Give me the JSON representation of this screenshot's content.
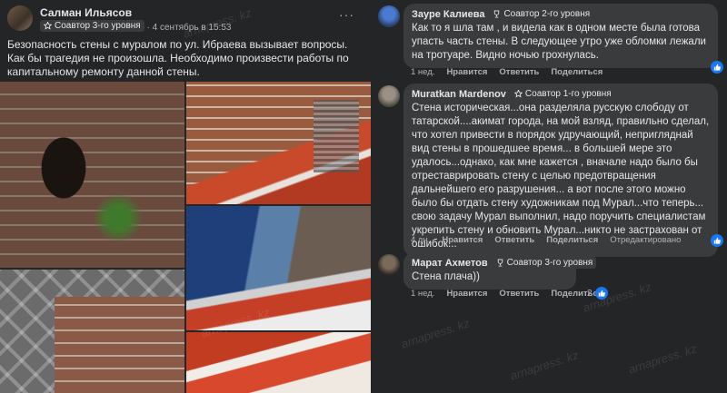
{
  "post": {
    "author": "Салман Ильясов",
    "badge": "Соавтор 3-го уровня",
    "separator": "·",
    "date": "4 сентябрь в 15:53",
    "dots": "···",
    "text": "Безопасность стены с муралом по ул. Ибраева вызывает вопросы. Как бы трагедия не произошла. Необходимо произвести работы по капитальному ремонту данной стены."
  },
  "comments": [
    {
      "author": "Зауре Калиева",
      "badge": "Соавтор 2-го уровня",
      "text": "Как то я шла там , и видела как в одном месте была готова упасть часть стены. В следующее утро уже обломки лежали на тротуаре. Видно ночью грохнулась.",
      "time": "1 нед.",
      "like": "Нравится",
      "reply": "Ответить",
      "share": "Поделиться"
    },
    {
      "author": "Muratkan Mardenov",
      "badge": "Соавтор 1-го уровня",
      "text": "Стена историческая...она разделяла русскую слободу от татарской....акимат города, на мой взляд, правильно сделал, что хотел привести в порядок удручающий, непригляднай вид стены в прошедшее время... в большей мере это удалось...однако, как мне кажется , вначале надо было бы отреставрировать стену с целью предотвращения дальнейшего его разрушения... а вот после этого можно было бы отдать стену художникам под Мурал...что теперь... свою задачу Мурал выполнил, надо поручить специалистам укрепить стену и обновить Мурал...никто не застрахован от ошибок...",
      "time": "4 дн.",
      "like": "Нравится",
      "reply": "Ответить",
      "share": "Поделиться",
      "edited": "Отредактировано"
    },
    {
      "author": "Марат Ахметов",
      "badge": "Соавтор 3-го уровня",
      "text": "Стена плача))",
      "time": "1 нед.",
      "like": "Нравится",
      "reply": "Ответить",
      "share": "Поделиться",
      "reactions": "2"
    }
  ],
  "watermark": "arnapress. kz",
  "colors": {
    "background": "#18191a",
    "card": "#242526",
    "bubble": "#3a3b3c",
    "like": "#1877f2"
  }
}
